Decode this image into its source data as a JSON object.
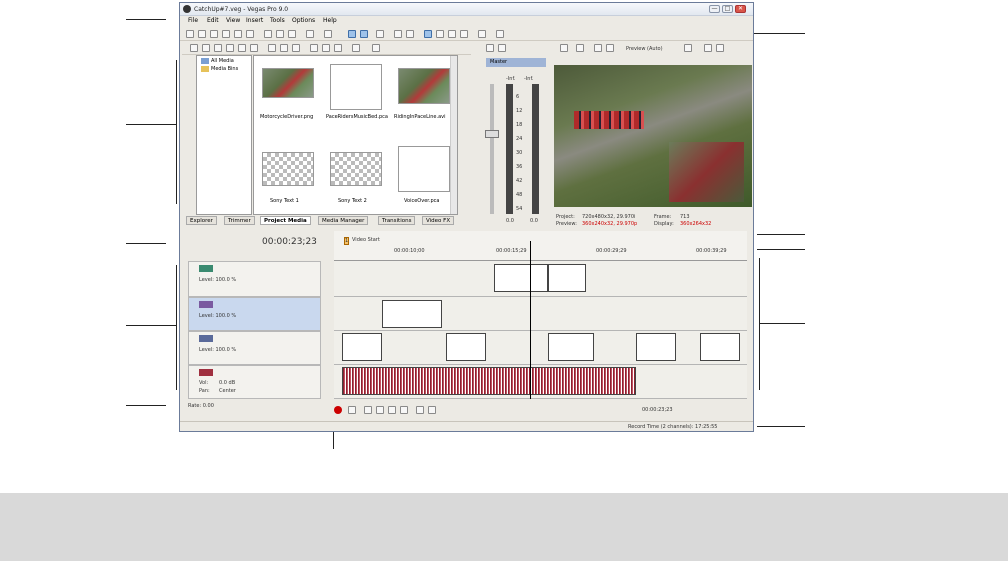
{
  "window": {
    "title": "CatchUp#7.veg - Vegas Pro 9.0",
    "controls": [
      "—",
      "□",
      "✕"
    ]
  },
  "menu": [
    "File",
    "Edit",
    "View",
    "Insert",
    "Tools",
    "Options",
    "Help"
  ],
  "explorer": {
    "tree": [
      "All Media",
      "Media Bins"
    ],
    "media": [
      {
        "label": "MotorcycleDriver.png",
        "kind": "photo"
      },
      {
        "label": "PaceRidersMusicBed.pca",
        "kind": "blank"
      },
      {
        "label": "RidingInPaceLine.avi",
        "kind": "photo"
      },
      {
        "label": "Sony Text 1",
        "kind": "checker"
      },
      {
        "label": "Sony Text 2",
        "kind": "checker"
      },
      {
        "label": "VoiceOver.pca",
        "kind": "blank"
      }
    ],
    "tabs": [
      "Explorer",
      "Trimmer",
      "Project Media",
      "Media Manager",
      "Transitions",
      "Video FX"
    ],
    "active_tab": "Project Media"
  },
  "mixer": {
    "bus": "Master",
    "peak_left": "-Inf.",
    "peak_right": "-Inf.",
    "scale": [
      "6",
      "12",
      "18",
      "24",
      "30",
      "36",
      "42",
      "48",
      "54"
    ],
    "db_left": "0.0",
    "db_right": "0.0"
  },
  "preview": {
    "mode": "Preview (Auto)",
    "project_label": "Project:",
    "project_value": "720x480x32, 29.970i",
    "preview_label": "Preview:",
    "preview_value": "360x240x32, 29.970p",
    "frame_label": "Frame:",
    "frame_value": "713",
    "display_label": "Display:",
    "display_value": "360x264x32"
  },
  "timeline": {
    "time": "00:00:23;23",
    "marker": "Video Start",
    "marker_num": "1",
    "ruler": [
      "00:00:10;00",
      "00:00:15;29",
      "00:00:29;29",
      "00:00:39;29"
    ],
    "tracks": [
      {
        "level": "Level: 100.0 %"
      },
      {
        "level": "Level: 100.0 %"
      },
      {
        "level": "Level: 100.0 %"
      }
    ],
    "audio": {
      "vol_label": "Vol:",
      "vol_value": "0.0 dB",
      "pan_label": "Pan:",
      "pan_value": "Center"
    },
    "rate": "Rate: 0.00",
    "transport_time": "00:00:23;23",
    "status": "Record Time (2 channels): 17:25:55"
  },
  "colors": {
    "accent": "#3f6fa8",
    "audio_wave": "#8b2030",
    "close": "#d9554a",
    "highlight": "#c00000"
  }
}
